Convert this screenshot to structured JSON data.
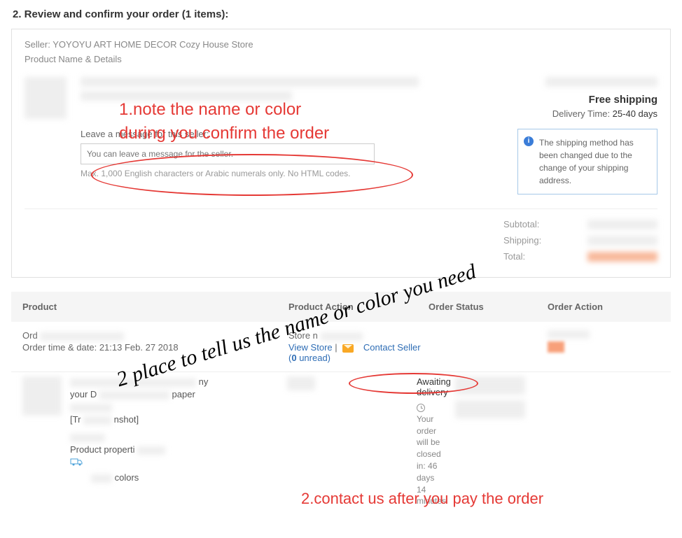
{
  "page_title": "2. Review and confirm your order (1 items):",
  "seller_label": "Seller: ",
  "seller_name": "YOYOYU ART HOME DECOR Cozy House Store",
  "product_name_details": "Product Name & Details",
  "message": {
    "label": "Leave a message for this seller:",
    "placeholder": "You can leave a message for the seller.",
    "hint": "Max. 1,000 English characters or Arabic numerals only. No HTML codes."
  },
  "shipping": {
    "free": "Free shipping",
    "delivery_label": "Delivery Time: ",
    "delivery_value": "25-40 days",
    "notice": "The shipping method has been changed due to the change of your shipping address."
  },
  "totals": {
    "subtotal": "Subtotal:",
    "shipping": "Shipping:",
    "total": "Total:"
  },
  "grid_headers": {
    "product": "Product",
    "product_action": "Product Action",
    "order_status": "Order Status",
    "order_action": "Order Action"
  },
  "order": {
    "ord_prefix": "Ord",
    "time_label": "Order time & date: ",
    "time_value": "21:13 Feb. 27 2018",
    "store_prefix": "Store n",
    "view_store": "View Store",
    "contact_seller": "Contact Seller (",
    "unread_count": "0",
    "unread_suffix": " unread)"
  },
  "row2": {
    "your": "your D",
    "paper": "paper",
    "tr": "[Tr",
    "inshot": "nshot]",
    "prop": "Product properti",
    "colors": "colors"
  },
  "status": {
    "awaiting": "Awaiting delivery",
    "close_prefix": "Your order will be closed in: ",
    "close_value": "46 days 14 minutes"
  },
  "annotations": {
    "note1_line1": "1.note the name or color",
    "note1_line2": "during you confirm the order",
    "note2": "2.contact us after you pay the order",
    "script": "2 place to tell us the name or color you need"
  }
}
